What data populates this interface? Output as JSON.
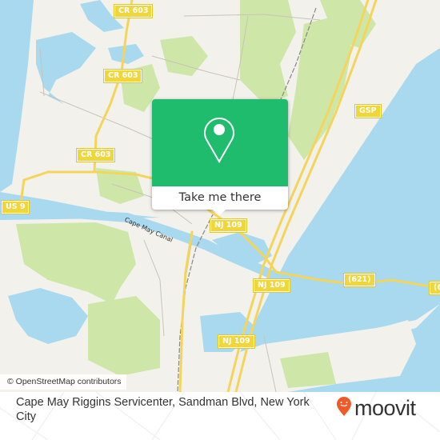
{
  "map": {
    "road_labels": [
      {
        "id": "cr603-top",
        "text": "CR 603"
      },
      {
        "id": "cr603-mid",
        "text": "CR 603"
      },
      {
        "id": "cr603-low",
        "text": "CR 603"
      },
      {
        "id": "us9",
        "text": "US 9"
      },
      {
        "id": "gsp",
        "text": "GSP"
      },
      {
        "id": "nj109-a",
        "text": "NJ 109"
      },
      {
        "id": "nj109-b",
        "text": "NJ 109"
      },
      {
        "id": "nj109-c",
        "text": "NJ 109"
      },
      {
        "id": "cr621",
        "text": "(621)"
      },
      {
        "id": "edge",
        "text": "(6"
      }
    ],
    "canal_label": "Cape May Canal",
    "attribution": "© OpenStreetMap contributors",
    "colors": {
      "water": "#a8d9ee",
      "land": "#f3f1ec",
      "park": "#cfe6a9",
      "road_major": "#f4d55c",
      "shield": "#f0d63a"
    }
  },
  "popup": {
    "icon": "map-pin-icon",
    "button_label": "Take me there",
    "color": "#1fbc6d"
  },
  "footer": {
    "address": "Cape May Riggins Servicenter, Sandman Blvd, New York City",
    "logo_text": "moovit",
    "logo_color": "#f05a28"
  }
}
